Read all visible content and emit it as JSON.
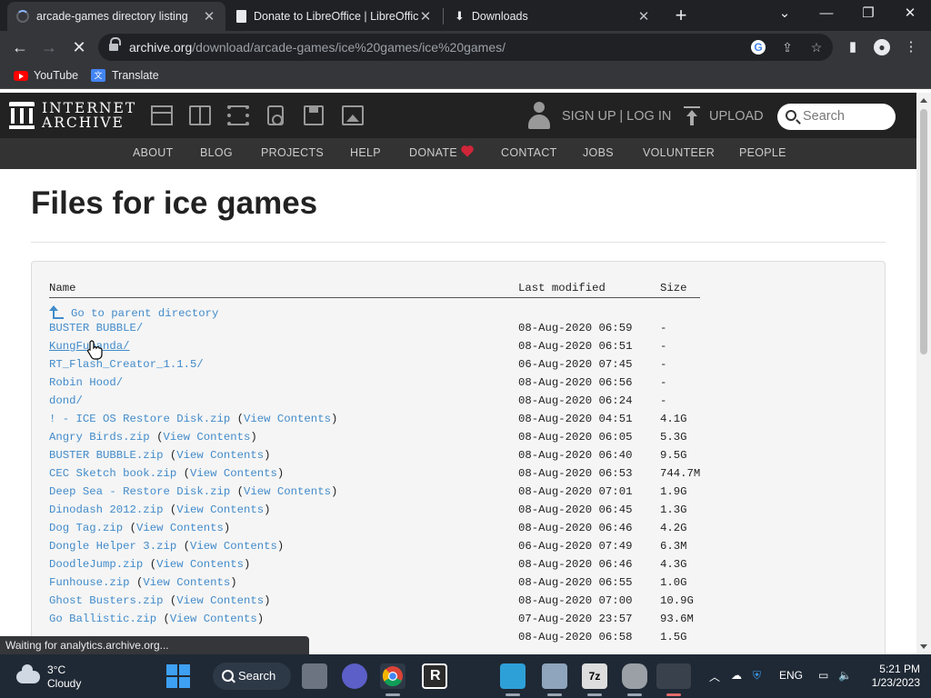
{
  "browser": {
    "tabs": [
      {
        "title": "arcade-games directory listing",
        "favicon": "loading-spinner-icon",
        "active": true
      },
      {
        "title": "Donate to LibreOffice | LibreOffice",
        "favicon": "document-icon",
        "active": false
      },
      {
        "title": "Downloads",
        "favicon": "download-icon",
        "active": false
      }
    ],
    "new_tab_glyph": "+",
    "url_host": "archive.org",
    "url_path": "/download/arcade-games/ice%20games/ice%20games/",
    "bookmarks": [
      {
        "label": "YouTube",
        "icon": "youtube-icon"
      },
      {
        "label": "Translate",
        "icon": "google-translate-icon"
      }
    ],
    "status_text": "Waiting for analytics.archive.org..."
  },
  "ia": {
    "logo_line1": "INTERNET",
    "logo_line2": "ARCHIVE",
    "auth_label": "SIGN UP | LOG IN",
    "upload_label": "UPLOAD",
    "search_placeholder": "Search",
    "nav": [
      "ABOUT",
      "BLOG",
      "PROJECTS",
      "HELP",
      "DONATE",
      "CONTACT",
      "JOBS",
      "VOLUNTEER",
      "PEOPLE"
    ]
  },
  "listing": {
    "title": "Files for ice games",
    "col_name": "Name",
    "col_modified": "Last modified",
    "col_size": "Size",
    "parent_label": "Go to parent directory",
    "view_contents_label": "View Contents",
    "rows": [
      {
        "name": "BUSTER BUBBLE/",
        "date": "08-Aug-2020 06:59",
        "size": "-",
        "zip": false
      },
      {
        "name": "KungFupanda/",
        "date": "08-Aug-2020 06:51",
        "size": "-",
        "zip": false
      },
      {
        "name": "RT_Flash_Creator_1.1.5/",
        "date": "06-Aug-2020 07:45",
        "size": "-",
        "zip": false
      },
      {
        "name": "Robin Hood/",
        "date": "08-Aug-2020 06:56",
        "size": "-",
        "zip": false
      },
      {
        "name": "dond/",
        "date": "08-Aug-2020 06:24",
        "size": "-",
        "zip": false
      },
      {
        "name": "! - ICE OS Restore Disk.zip",
        "date": "08-Aug-2020 04:51",
        "size": "4.1G",
        "zip": true
      },
      {
        "name": "Angry Birds.zip",
        "date": "08-Aug-2020 06:05",
        "size": "5.3G",
        "zip": true
      },
      {
        "name": "BUSTER BUBBLE.zip",
        "date": "08-Aug-2020 06:40",
        "size": "9.5G",
        "zip": true
      },
      {
        "name": "CEC Sketch book.zip",
        "date": "08-Aug-2020 06:53",
        "size": "744.7M",
        "zip": true
      },
      {
        "name": "Deep Sea - Restore Disk.zip",
        "date": "08-Aug-2020 07:01",
        "size": "1.9G",
        "zip": true
      },
      {
        "name": "Dinodash 2012.zip",
        "date": "08-Aug-2020 06:45",
        "size": "1.3G",
        "zip": true
      },
      {
        "name": "Dog Tag.zip",
        "date": "08-Aug-2020 06:46",
        "size": "4.2G",
        "zip": true
      },
      {
        "name": "Dongle Helper 3.zip",
        "date": "06-Aug-2020 07:49",
        "size": "6.3M",
        "zip": true
      },
      {
        "name": "DoodleJump.zip",
        "date": "08-Aug-2020 06:46",
        "size": "4.3G",
        "zip": true
      },
      {
        "name": "Funhouse.zip",
        "date": "08-Aug-2020 06:55",
        "size": "1.0G",
        "zip": true
      },
      {
        "name": "Ghost Busters.zip",
        "date": "08-Aug-2020 07:00",
        "size": "10.9G",
        "zip": true
      },
      {
        "name": "Go Ballistic.zip",
        "date": "07-Aug-2020 23:57",
        "size": "93.6M",
        "zip": true
      },
      {
        "name": "",
        "date": "08-Aug-2020 06:58",
        "size": "1.5G",
        "zip": false
      }
    ]
  },
  "taskbar": {
    "temperature": "3°C",
    "condition": "Cloudy",
    "search_label": "Search",
    "language": "ENG",
    "time": "5:21 PM",
    "date": "1/23/2023"
  }
}
